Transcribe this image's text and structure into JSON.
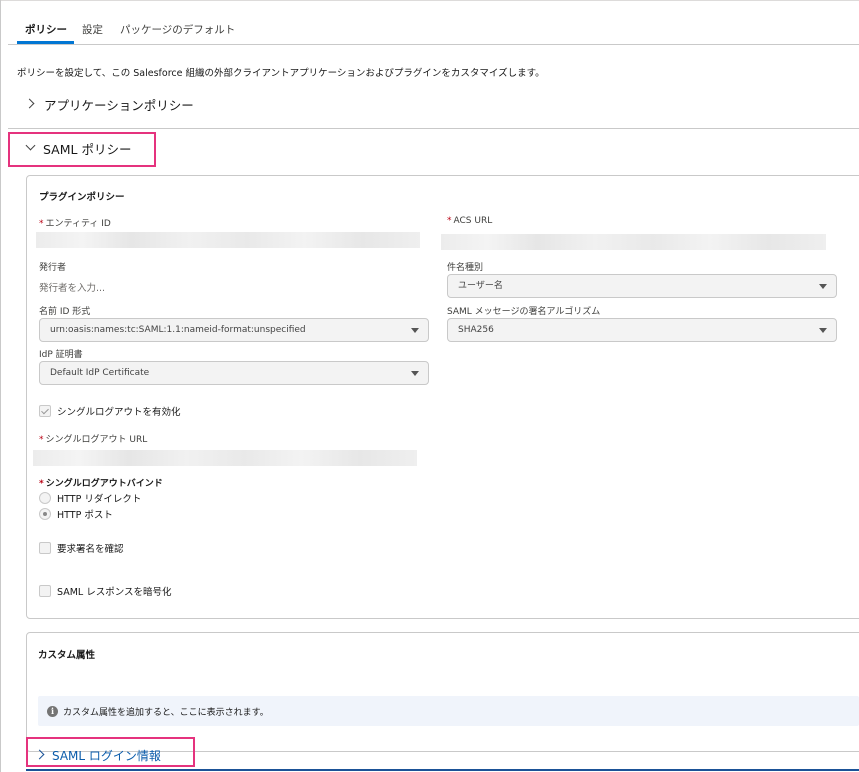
{
  "tabs": [
    {
      "label": "ポリシー",
      "active": true
    },
    {
      "label": "設定",
      "active": false
    },
    {
      "label": "パッケージのデフォルト",
      "active": false
    }
  ],
  "intro_text": "ポリシーを設定して、この Salesforce 組織の外部クライアントアプリケーションおよびプラグインをカスタマイズします。",
  "sections": {
    "app_policy": {
      "title": "アプリケーションポリシー",
      "expanded": false
    },
    "saml_policy": {
      "title": "SAML ポリシー",
      "expanded": true
    },
    "saml_login": {
      "title": "SAML ログイン情報",
      "expanded": false
    }
  },
  "plugin_policy": {
    "title": "プラグインポリシー",
    "entity_id": {
      "label": "エンティティ ID",
      "required_mark": "*"
    },
    "acs_url": {
      "label": "ACS URL",
      "required_mark": "*"
    },
    "issuer": {
      "label": "発行者",
      "placeholder": "発行者を入力..."
    },
    "subject_type": {
      "label": "件名種別",
      "value": "ユーザー名"
    },
    "name_id_format": {
      "label": "名前 ID 形式",
      "value": "urn:oasis:names:tc:SAML:1.1:nameid-format:unspecified"
    },
    "signing_algorithm": {
      "label": "SAML メッセージの署名アルゴリズム",
      "value": "SHA256"
    },
    "idp_certificate": {
      "label": "IdP 証明書",
      "value": "Default IdP Certificate"
    },
    "single_logout": {
      "label": "シングルログアウトを有効化",
      "checked": true
    },
    "single_logout_url": {
      "label": "シングルログアウト URL",
      "required_mark": "*"
    },
    "single_logout_binding": {
      "label": "シングルログアウトバインド",
      "required_mark": "*",
      "options": [
        {
          "label": "HTTP リダイレクト",
          "selected": false
        },
        {
          "label": "HTTP ポスト",
          "selected": true
        }
      ]
    },
    "verify_request_signature": {
      "label": "要求署名を確認",
      "checked": false
    },
    "encrypt_saml_response": {
      "label": "SAML レスポンスを暗号化",
      "checked": false
    }
  },
  "custom_attributes": {
    "title": "カスタム属性",
    "info_text": "カスタム属性を追加すると、ここに表示されます。",
    "info_icon": "info-icon"
  },
  "colors": {
    "accent": "#0176d3",
    "highlight": "#e5337e",
    "link": "#0b5cab",
    "required": "#ba0517"
  }
}
